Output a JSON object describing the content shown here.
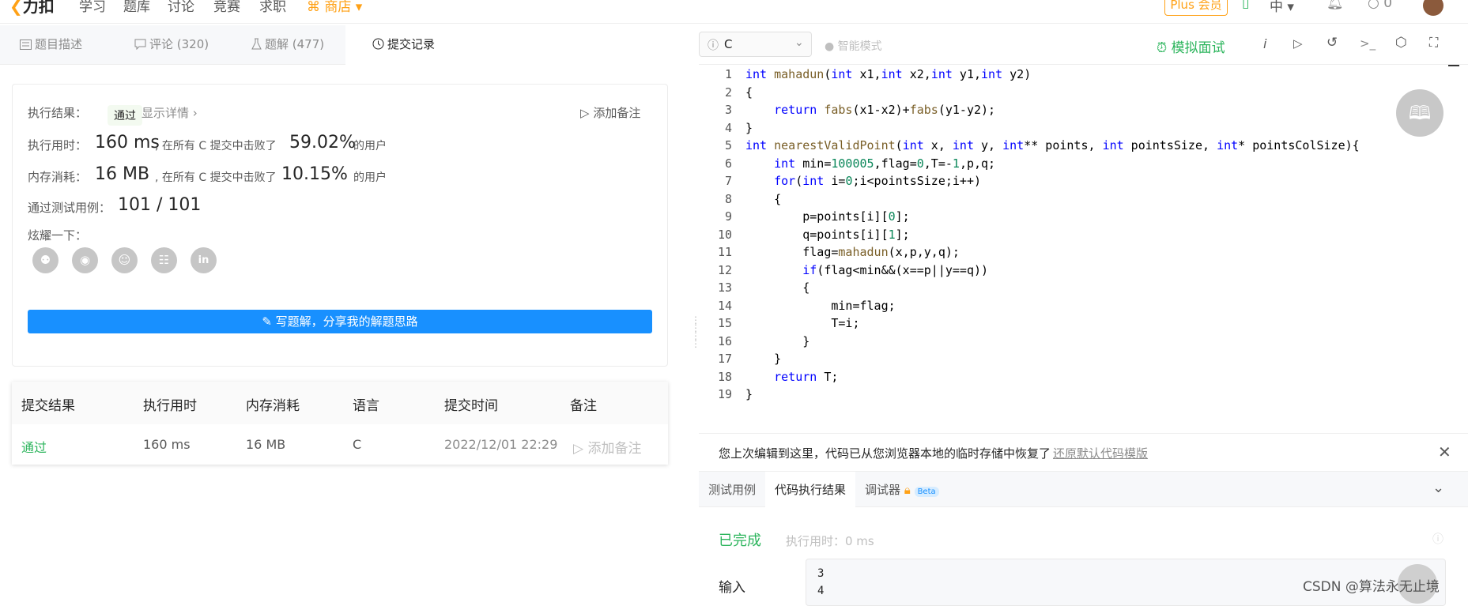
{
  "topnav": {
    "logo": "力扣",
    "items": [
      "学习",
      "题库",
      "讨论",
      "竞赛",
      "求职"
    ],
    "store": "商店",
    "plus": "Plus 会员",
    "lang": "中",
    "points": "0"
  },
  "left_tabs": [
    {
      "label": "题目描述"
    },
    {
      "label": "评论 (320)"
    },
    {
      "label": "题解 (477)"
    },
    {
      "label": "提交记录"
    }
  ],
  "result_card": {
    "exec_result_label": "执行结果：",
    "exec_result_value": "通过",
    "show_details": "显示详情 ›",
    "add_note": "添加备注",
    "time_label": "执行用时：",
    "time_value": "160 ms",
    "time_beat_text": ", 在所有 C 提交中击败了",
    "time_pct": "59.02%",
    "time_users": "的用户",
    "mem_label": "内存消耗：",
    "mem_value": "16 MB",
    "mem_beat_text": ", 在所有 C 提交中击败了",
    "mem_pct": "10.15%",
    "mem_users": "的用户",
    "tests_label": "通过测试用例：",
    "tests_value": "101 / 101",
    "share_label": "炫耀一下：",
    "write_solution": "写题解，分享我的解题思路"
  },
  "submissions": {
    "headers": [
      "提交结果",
      "执行用时",
      "内存消耗",
      "语言",
      "提交时间",
      "备注"
    ],
    "row": {
      "result": "通过",
      "time": "160 ms",
      "memory": "16 MB",
      "lang": "C",
      "submitted": "2022/12/01 22:29",
      "note": "添加备注"
    }
  },
  "editor_toolbar": {
    "language": "C",
    "smart_mode": "智能模式",
    "mock_interview": "模拟面试"
  },
  "code_lines": [
    "int mahadun(int x1,int x2,int y1,int y2)",
    "{",
    "    return fabs(x1-x2)+fabs(y1-y2);",
    "}",
    "int nearestValidPoint(int x, int y, int** points, int pointsSize, int* pointsColSize){",
    "    int min=100005,flag=0,T=-1,p,q;",
    "    for(int i=0;i<pointsSize;i++)",
    "    {",
    "        p=points[i][0];",
    "        q=points[i][1];",
    "        flag=mahadun(x,p,y,q);",
    "        if(flag<min&&(x==p||y==q))",
    "        {",
    "            min=flag;",
    "            T=i;",
    "        }",
    "    }",
    "    return T;",
    "}"
  ],
  "notice": {
    "text": "您上次编辑到这里，代码已从您浏览器本地的临时存储中恢复了",
    "link": "还原默认代码模版"
  },
  "bottom_tabs": {
    "testcase": "测试用例",
    "exec_result": "代码执行结果",
    "debugger": "调试器",
    "beta": "Beta"
  },
  "run_result": {
    "status": "已完成",
    "time": "执行用时：0 ms",
    "input_label": "输入",
    "input_lines": [
      "3",
      "4"
    ]
  },
  "watermark": "CSDN @算法永无止境",
  "colors": {
    "accent_blue": "#1890ff",
    "pass_green": "#2db55d",
    "plus_orange": "#ffa116"
  }
}
